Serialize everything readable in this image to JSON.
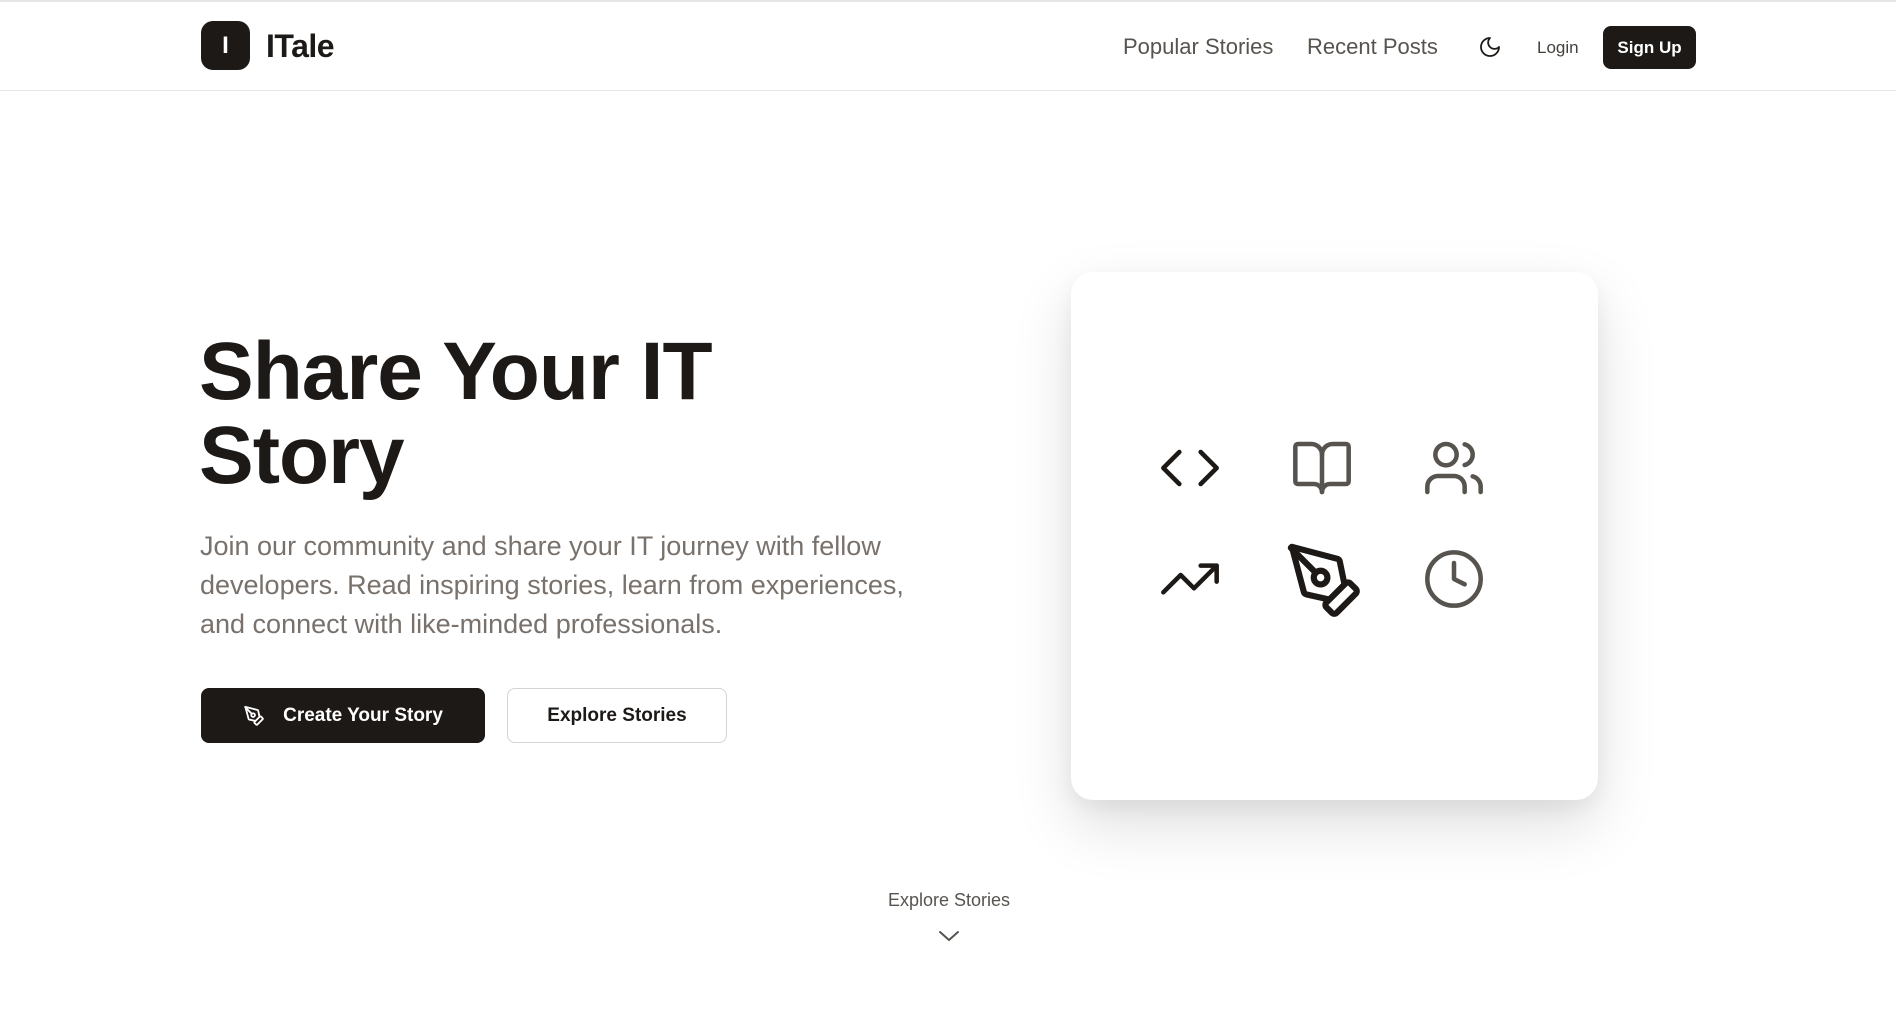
{
  "header": {
    "logo_letter": "I",
    "brand": "ITale",
    "nav": [
      "Popular Stories",
      "Recent Posts"
    ],
    "theme_icon": "moon-icon",
    "login_label": "Login",
    "signup_label": "Sign Up"
  },
  "hero": {
    "title_line1": "Share Your IT",
    "title_line2": "Story",
    "subtitle": "Join our community and share your IT journey with fellow developers. Read inspiring stories, learn from experiences, and connect with like-minded professionals.",
    "primary_button": "Create Your Story",
    "primary_button_icon": "pen-tool-icon",
    "secondary_button": "Explore Stories"
  },
  "feature_card": {
    "icons": [
      "code-icon",
      "book-open-icon",
      "users-icon",
      "trending-up-icon",
      "pen-tool-icon",
      "clock-icon"
    ]
  },
  "scroll_hint": {
    "label": "Explore Stories",
    "icon": "chevron-down-icon"
  },
  "colors": {
    "primary": "#1c1917",
    "muted_text": "#78716c",
    "border": "#e7e5e4",
    "background": "#ffffff"
  }
}
